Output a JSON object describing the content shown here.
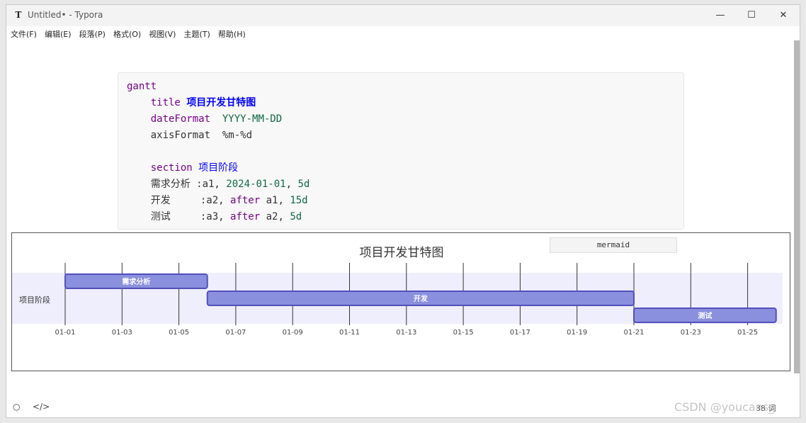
{
  "window": {
    "title": "Untitled• - Typora",
    "app_icon": "T",
    "controls": {
      "minimize": "—",
      "maximize": "☐",
      "close": "✕"
    }
  },
  "menu": [
    "文件(F)",
    "编辑(E)",
    "段落(P)",
    "格式(O)",
    "视图(V)",
    "主题(T)",
    "帮助(H)"
  ],
  "code": {
    "l1": "gantt",
    "title_kw": "title",
    "title_text": "项目开发甘特图",
    "date_kw": "dateFormat",
    "date_val": "YYYY-MM-DD",
    "axis_line": "axisFormat  %m-%d",
    "section_kw": "section",
    "section_text": "项目阶段",
    "t1_name": "需求分析 :a1, ",
    "t1_date": "2024-01-01",
    "t1_sep": ", ",
    "t1_dur": "5d",
    "t2_name": "开发     :a2, ",
    "t2_after": "after",
    "t2_ref": " a1, ",
    "t2_dur": "15d",
    "t3_name": "测试     :a3, ",
    "t3_after": "after",
    "t3_ref": " a2, ",
    "t3_dur": "5d"
  },
  "lang_tag": "mermaid",
  "chart_data": {
    "type": "gantt",
    "title": "项目开发甘特图",
    "section": "项目阶段",
    "date_format": "YYYY-MM-DD",
    "axis_format": "%m-%d",
    "x_start": "2024-01-01",
    "x_end": "2024-01-26",
    "ticks": [
      "01-01",
      "01-03",
      "01-05",
      "01-07",
      "01-09",
      "01-11",
      "01-13",
      "01-15",
      "01-17",
      "01-19",
      "01-21",
      "01-23",
      "01-25"
    ],
    "tasks": [
      {
        "id": "a1",
        "name": "需求分析",
        "start": "2024-01-01",
        "end": "2024-01-06"
      },
      {
        "id": "a2",
        "name": "开发",
        "start": "2024-01-06",
        "end": "2024-01-21"
      },
      {
        "id": "a3",
        "name": "测试",
        "start": "2024-01-21",
        "end": "2024-01-26"
      }
    ],
    "colors": {
      "task_fill": "#8a90dd",
      "task_stroke": "#534fbc",
      "section_band": "#efeefd",
      "grid": "#333333"
    }
  },
  "status": {
    "outline_icon": "circle-icon",
    "source_icon": "code-icon",
    "word_count": "38 词"
  },
  "watermark": "CSDN @youcans_"
}
